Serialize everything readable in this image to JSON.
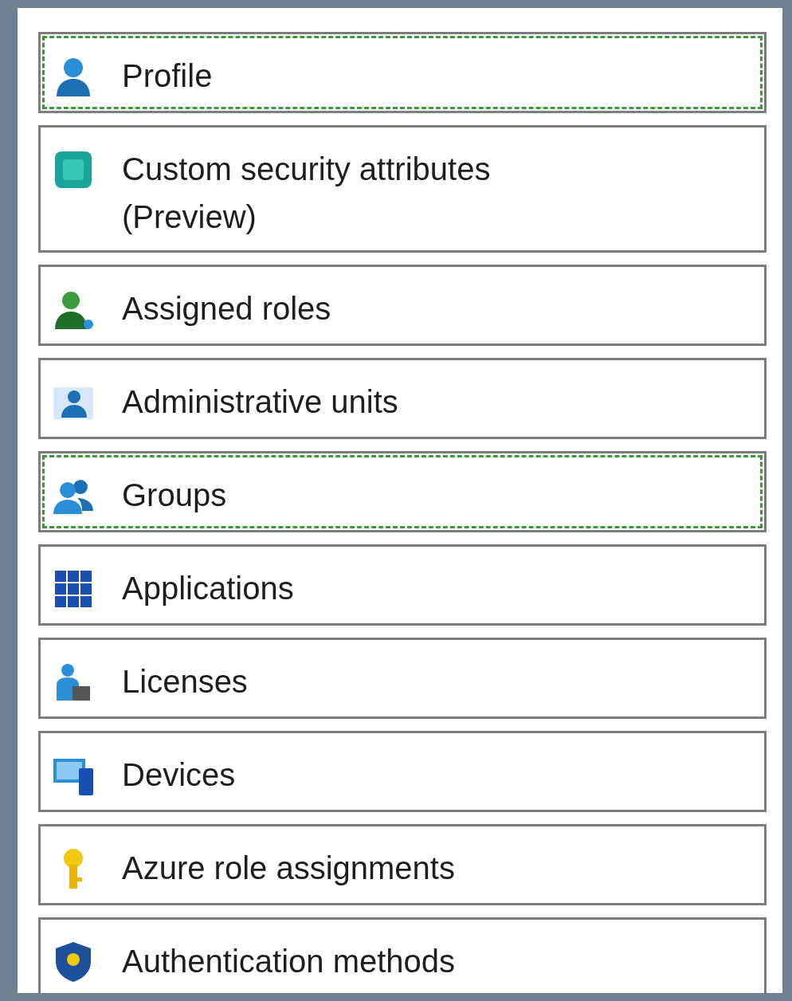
{
  "menu_items": [
    {
      "label": "Profile",
      "kind": "person",
      "selected": true
    },
    {
      "label": "Custom security attributes (Preview)",
      "kind": "tile",
      "selected": false
    },
    {
      "label": "Assigned roles",
      "kind": "role",
      "selected": false
    },
    {
      "label": "Administrative units",
      "kind": "unit",
      "selected": false
    },
    {
      "label": "Groups",
      "kind": "people",
      "selected": true
    },
    {
      "label": "Applications",
      "kind": "grid",
      "selected": false
    },
    {
      "label": "Licenses",
      "kind": "license",
      "selected": false
    },
    {
      "label": "Devices",
      "kind": "devices",
      "selected": false
    },
    {
      "label": "Azure role assignments",
      "kind": "key",
      "selected": false
    },
    {
      "label": "Authentication methods",
      "kind": "shield",
      "selected": false
    }
  ]
}
